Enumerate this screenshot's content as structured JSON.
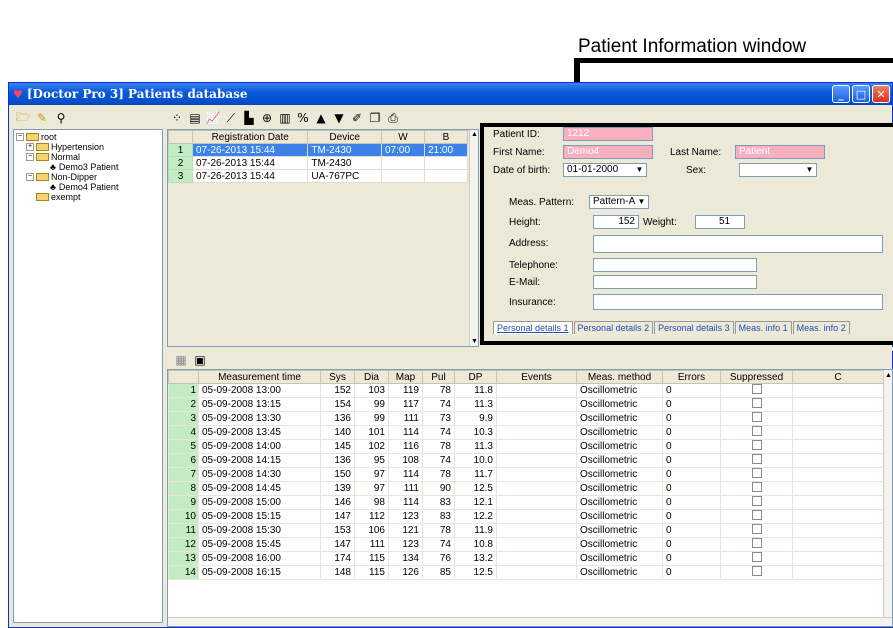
{
  "annotation": {
    "label": "Patient Information window"
  },
  "window": {
    "title": "[Doctor Pro 3] Patients database",
    "buttons": [
      "_",
      "□",
      "X"
    ]
  },
  "tree": {
    "items": [
      {
        "label": "root",
        "level": 0,
        "expander": "−",
        "icon": "folder-icon"
      },
      {
        "label": "Hypertension",
        "level": 1,
        "expander": "+",
        "icon": "folder-icon"
      },
      {
        "label": "Normal",
        "level": 1,
        "expander": "−",
        "icon": "folder-icon"
      },
      {
        "label": "Demo3 Patient",
        "level": 2,
        "expander": "",
        "icon": "patient-icon"
      },
      {
        "label": "Non-Dipper",
        "level": 1,
        "expander": "−",
        "icon": "folder-icon"
      },
      {
        "label": "Demo4 Patient",
        "level": 2,
        "expander": "",
        "icon": "patient-icon"
      },
      {
        "label": "exempt",
        "level": 1,
        "expander": "",
        "icon": "folder-icon"
      }
    ]
  },
  "registrations": {
    "headers": [
      "",
      "Registration Date",
      "Device",
      "W",
      "B"
    ],
    "rows": [
      [
        "1",
        "07-26-2013 15:44",
        "TM-2430",
        "07:00",
        "21:00"
      ],
      [
        "2",
        "07-26-2013 15:44",
        "TM-2430",
        "",
        ""
      ],
      [
        "3",
        "07-26-2013 15:44",
        "UA-767PC",
        "",
        ""
      ]
    ]
  },
  "patient": {
    "id_label": "Patient ID:",
    "id_value": "1212",
    "first_name_label": "First Name:",
    "first_name_value": "Demo4",
    "last_name_label": "Last Name:",
    "last_name_value": "Patient",
    "dob_label": "Date of birth:",
    "dob_value": "01-01-2000",
    "sex_label": "Sex:",
    "sex_value": "",
    "pattern_label": "Meas. Pattern:",
    "pattern_value": "Pattern-A",
    "height_label": "Height:",
    "height_value": "152",
    "weight_label": "Weight:",
    "weight_value": "51",
    "address_label": "Address:",
    "address_value": "",
    "telephone_label": "Telephone:",
    "telephone_value": "",
    "email_label": "E-Mail:",
    "email_value": "",
    "insurance_label": "Insurance:",
    "insurance_value": "",
    "tabs": [
      "Personal details 1",
      "Personal details 2",
      "Personal details 3",
      "Meas. info 1",
      "Meas. info 2"
    ]
  },
  "measurements": {
    "headers": [
      "",
      "Measurement time",
      "Sys",
      "Dia",
      "Map",
      "Pul",
      "DP",
      "Events",
      "Meas. method",
      "Errors",
      "Suppressed",
      "C"
    ],
    "rows": [
      [
        "1",
        "05-09-2008 13:00",
        "152",
        "103",
        "119",
        "78",
        "11.8",
        "",
        "Oscillometric",
        "0"
      ],
      [
        "2",
        "05-09-2008 13:15",
        "154",
        "99",
        "117",
        "74",
        "11.3",
        "",
        "Oscillometric",
        "0"
      ],
      [
        "3",
        "05-09-2008 13:30",
        "136",
        "99",
        "111",
        "73",
        "9.9",
        "",
        "Oscillometric",
        "0"
      ],
      [
        "4",
        "05-09-2008 13:45",
        "140",
        "101",
        "114",
        "74",
        "10.3",
        "",
        "Oscillometric",
        "0"
      ],
      [
        "5",
        "05-09-2008 14:00",
        "145",
        "102",
        "116",
        "78",
        "11.3",
        "",
        "Oscillometric",
        "0"
      ],
      [
        "6",
        "05-09-2008 14:15",
        "136",
        "95",
        "108",
        "74",
        "10.0",
        "",
        "Oscillometric",
        "0"
      ],
      [
        "7",
        "05-09-2008 14:30",
        "150",
        "97",
        "114",
        "78",
        "11.7",
        "",
        "Oscillometric",
        "0"
      ],
      [
        "8",
        "05-09-2008 14:45",
        "139",
        "97",
        "111",
        "90",
        "12.5",
        "",
        "Oscillometric",
        "0"
      ],
      [
        "9",
        "05-09-2008 15:00",
        "146",
        "98",
        "114",
        "83",
        "12.1",
        "",
        "Oscillometric",
        "0"
      ],
      [
        "10",
        "05-09-2008 15:15",
        "147",
        "112",
        "123",
        "83",
        "12.2",
        "",
        "Oscillometric",
        "0"
      ],
      [
        "11",
        "05-09-2008 15:30",
        "153",
        "106",
        "121",
        "78",
        "11.9",
        "",
        "Oscillometric",
        "0"
      ],
      [
        "12",
        "05-09-2008 15:45",
        "147",
        "111",
        "123",
        "74",
        "10.8",
        "",
        "Oscillometric",
        "0"
      ],
      [
        "13",
        "05-09-2008 16:00",
        "174",
        "115",
        "134",
        "76",
        "13.2",
        "",
        "Oscillometric",
        "0"
      ],
      [
        "14",
        "05-09-2008 16:15",
        "148",
        "115",
        "126",
        "85",
        "12.5",
        "",
        "Oscillometric",
        "0"
      ]
    ]
  }
}
